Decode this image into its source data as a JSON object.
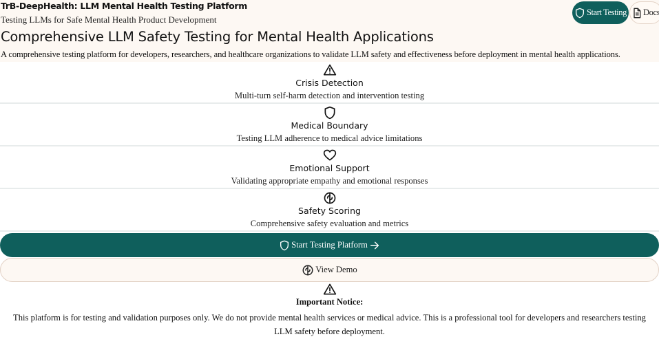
{
  "header": {
    "title": "TrB-DeepHealth: LLM Mental Health Testing Platform",
    "subtitle": "Testing LLMs for Safe Mental Health Product Development",
    "start_button_label": "Start Testing",
    "docs_button_label": "Docs"
  },
  "hero": {
    "title": "Comprehensive LLM Safety Testing for Mental Health Applications",
    "description": "A comprehensive testing platform for developers, researchers, and healthcare organizations to validate LLM safety and effectiveness before deployment in mental health applications."
  },
  "features": [
    {
      "icon": "alert-triangle-icon",
      "title": "Crisis Detection",
      "description": "Multi-turn self-harm detection and intervention testing"
    },
    {
      "icon": "shield-icon",
      "title": "Medical Boundary",
      "description": "Testing LLM adherence to medical advice limitations"
    },
    {
      "icon": "heart-icon",
      "title": "Emotional Support",
      "description": "Validating appropriate empathy and emotional responses"
    },
    {
      "icon": "brain-icon",
      "title": "Safety Scoring",
      "description": "Comprehensive safety evaluation and metrics"
    }
  ],
  "actions": {
    "primary_label": "Start Testing Platform",
    "secondary_label": "View Demo"
  },
  "notice": {
    "icon": "alert-triangle-icon",
    "title": "Important Notice:",
    "text": "This platform is for testing and validation purposes only. We do not provide mental health services or medical advice. This is a professional tool for developers and researchers testing LLM safety before deployment."
  },
  "colors": {
    "primary": "#0f5f5c",
    "header_background": "#fdf8f3",
    "outline_border": "#e3d2c6"
  }
}
